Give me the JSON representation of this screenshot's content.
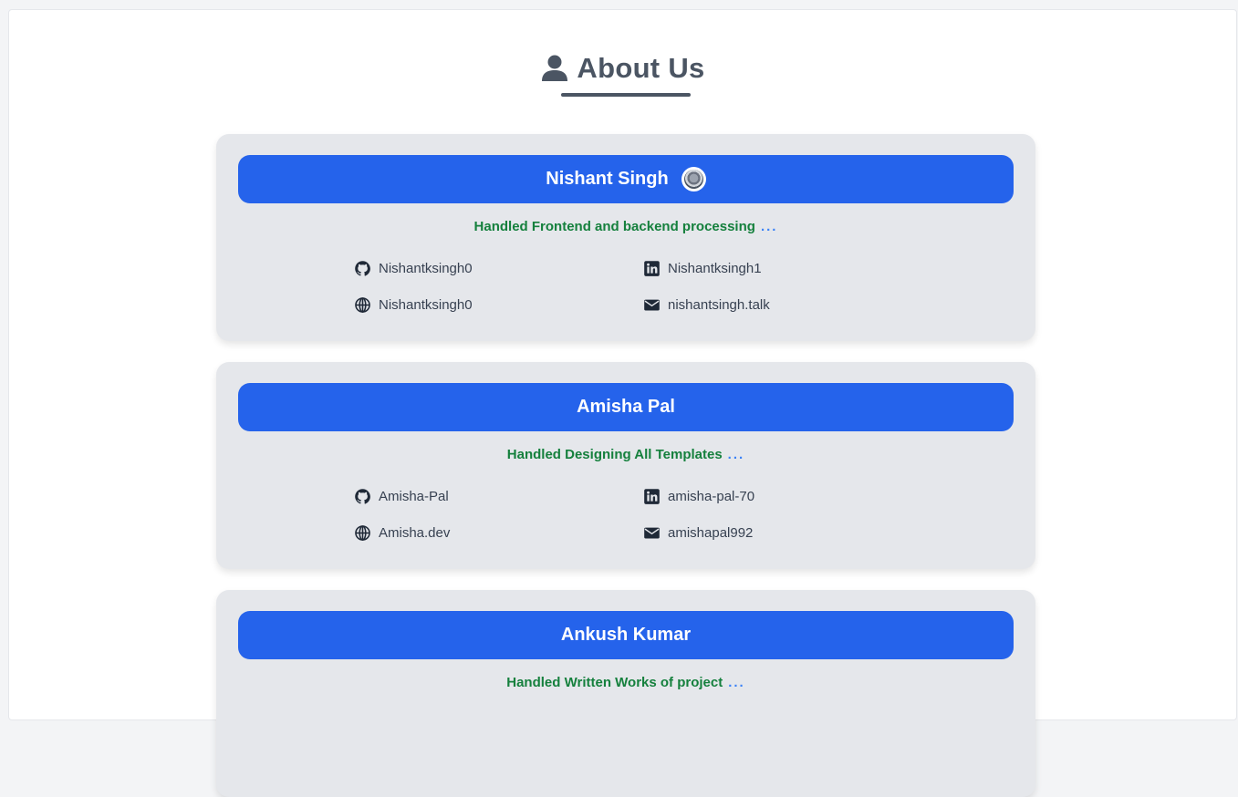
{
  "header": {
    "title": "About Us",
    "icon": "user-icon"
  },
  "colors": {
    "accent": "#2563eb",
    "role_text": "#15803d",
    "dots": "#3b82f6",
    "card_bg": "#e5e7eb",
    "title": "#4b5563"
  },
  "members": [
    {
      "name": "Nishant Singh",
      "has_avatar": true,
      "role": "Handled Frontend and backend processing",
      "dots": "...",
      "github": "Nishantksingh0",
      "linkedin": "Nishantksingh1",
      "website": "Nishantksingh0",
      "email": "nishantsingh.talk"
    },
    {
      "name": "Amisha Pal",
      "has_avatar": false,
      "role": "Handled Designing All Templates",
      "dots": "...",
      "github": "Amisha-Pal",
      "linkedin": "amisha-pal-70",
      "website": "Amisha.dev",
      "email": "amishapal992"
    },
    {
      "name": "Ankush Kumar",
      "has_avatar": false,
      "role": "Handled Written Works of project",
      "dots": "..."
    }
  ]
}
